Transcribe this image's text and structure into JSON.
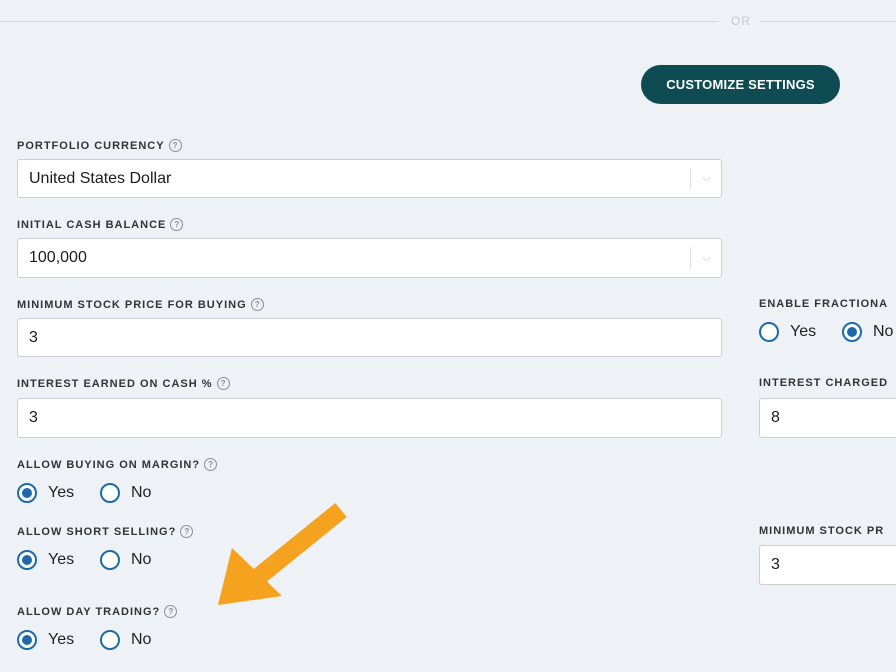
{
  "divider": {
    "label": "OR"
  },
  "customize": {
    "label": "CUSTOMIZE SETTINGS"
  },
  "portfolio_currency": {
    "label": "PORTFOLIO CURRENCY",
    "value": "United States Dollar"
  },
  "initial_cash": {
    "label": "INITIAL CASH BALANCE",
    "value": "100,000"
  },
  "min_stock_price_buy": {
    "label": "MINIMUM STOCK PRICE FOR BUYING",
    "value": "3"
  },
  "interest_earned": {
    "label": "INTEREST EARNED ON CASH %",
    "value": "3"
  },
  "allow_margin": {
    "label": "ALLOW BUYING ON MARGIN?",
    "yes": "Yes",
    "no": "No",
    "selected": "Yes"
  },
  "allow_short": {
    "label": "ALLOW SHORT SELLING?",
    "yes": "Yes",
    "no": "No",
    "selected": "Yes"
  },
  "allow_day_trading": {
    "label": "ALLOW DAY TRADING?",
    "yes": "Yes",
    "no": "No",
    "selected": "Yes"
  },
  "enable_fractional": {
    "label": "ENABLE FRACTIONA",
    "yes": "Yes",
    "no": "No",
    "selected": "No"
  },
  "interest_charged": {
    "label": "INTEREST CHARGED",
    "value": "8"
  },
  "min_stock_price_right": {
    "label": "MINIMUM STOCK PR",
    "value": "3"
  },
  "help_glyph": "?",
  "chevron_glyph": "⌵",
  "colors": {
    "primary": "#0f4b52",
    "radio": "#1e6aa8",
    "arrow": "#f5a21e",
    "background": "#eef1f6"
  },
  "icons": {
    "help": "question-circle-icon",
    "chevron": "chevron-down-icon",
    "annotation": "orange-arrow-icon"
  }
}
